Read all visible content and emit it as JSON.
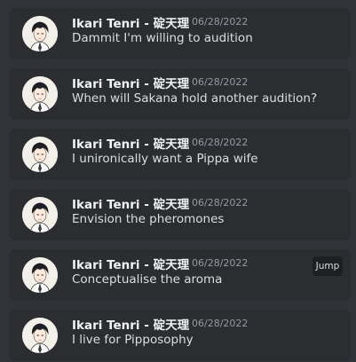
{
  "messages": [
    {
      "author": "Ikari Tenri - 碇天理",
      "timestamp": "06/28/2022",
      "text": "Dammit I'm willing to audition",
      "avatar_icon": "anime-avatar-icon"
    },
    {
      "author": "Ikari Tenri - 碇天理",
      "timestamp": "06/28/2022",
      "text": "When will Sakana hold another audition?",
      "avatar_icon": "anime-avatar-icon"
    },
    {
      "author": "Ikari Tenri - 碇天理",
      "timestamp": "06/28/2022",
      "text": "I unironically want a Pippa wife",
      "avatar_icon": "anime-avatar-icon"
    },
    {
      "author": "Ikari Tenri - 碇天理",
      "timestamp": "06/28/2022",
      "text": "Envision the pheromones",
      "avatar_icon": "anime-avatar-icon"
    },
    {
      "author": "Ikari Tenri - 碇天理",
      "timestamp": "06/28/2022",
      "text": "Conceptualise the aroma",
      "avatar_icon": "anime-avatar-icon",
      "jump_label": "Jump"
    },
    {
      "author": "Ikari Tenri - 碇天理",
      "timestamp": "06/28/2022",
      "text": "I live for Pipposophy",
      "avatar_icon": "anime-avatar-icon"
    }
  ],
  "colors": {
    "background": "#313338",
    "card": "#2b2d31",
    "author": "#f2f3f5",
    "timestamp": "#949ba4",
    "text": "#dbdee1"
  }
}
